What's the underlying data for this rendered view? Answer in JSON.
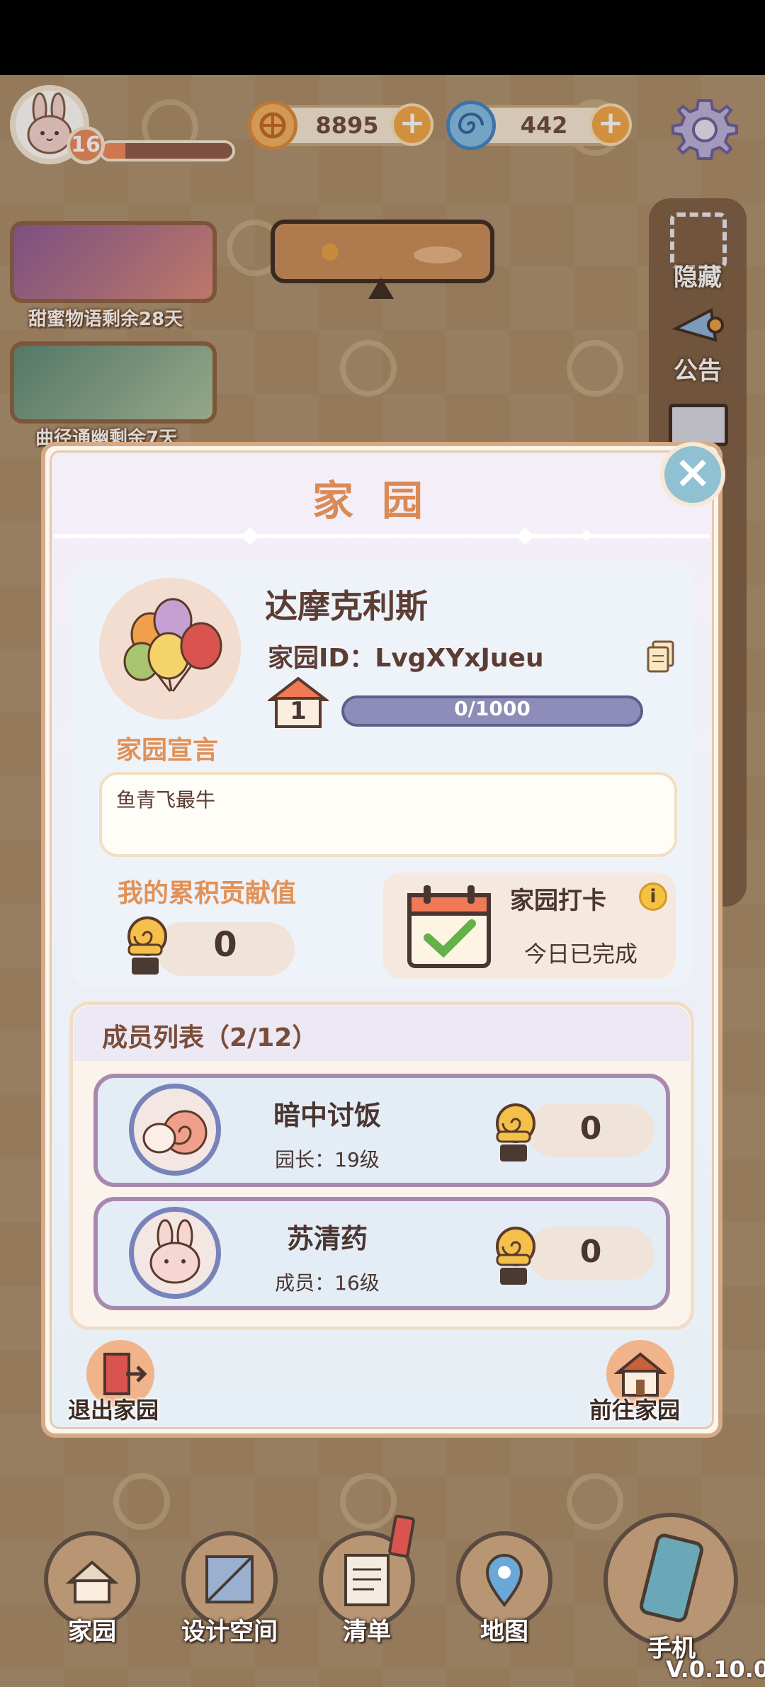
{
  "hud": {
    "level": "16",
    "xp_fraction": 0.18,
    "coins": "8895",
    "gems": "442"
  },
  "events": [
    {
      "label": "甜蜜物语剩余28天"
    },
    {
      "label": "曲径通幽剩余7天"
    }
  ],
  "side_menu": {
    "hide_label": "隐藏",
    "notice_label": "公告"
  },
  "panel": {
    "title": "家园",
    "home_name": "达摩克利斯",
    "home_id_label": "家园ID：LvgXYxJueu",
    "home_level": "1",
    "progress_text": "0/1000",
    "progress_fraction": 0.0,
    "declaration_label": "家园宣言",
    "declaration_text": "鱼青飞最牛",
    "contribution_label": "我的累积贡献值",
    "contribution_value": "0",
    "checkin_title": "家园打卡",
    "checkin_status": "今日已完成",
    "members_title": "成员列表（2/12）",
    "members": [
      {
        "name": "暗中讨饭",
        "role": "园长：19级",
        "value": "0"
      },
      {
        "name": "苏清药",
        "role": "成员：16级",
        "value": "0"
      }
    ],
    "leave_label": "退出家园",
    "goto_label": "前往家园"
  },
  "nav": {
    "home": "家园",
    "design": "设计空间",
    "list": "清单",
    "map": "地图",
    "phone": "手机"
  },
  "version": "V.0.10.0",
  "colors": {
    "accent_orange": "#e19156",
    "panel_border": "#d7aa86",
    "member_border": "#a889ad",
    "progress_fill": "#8e8cb8"
  }
}
